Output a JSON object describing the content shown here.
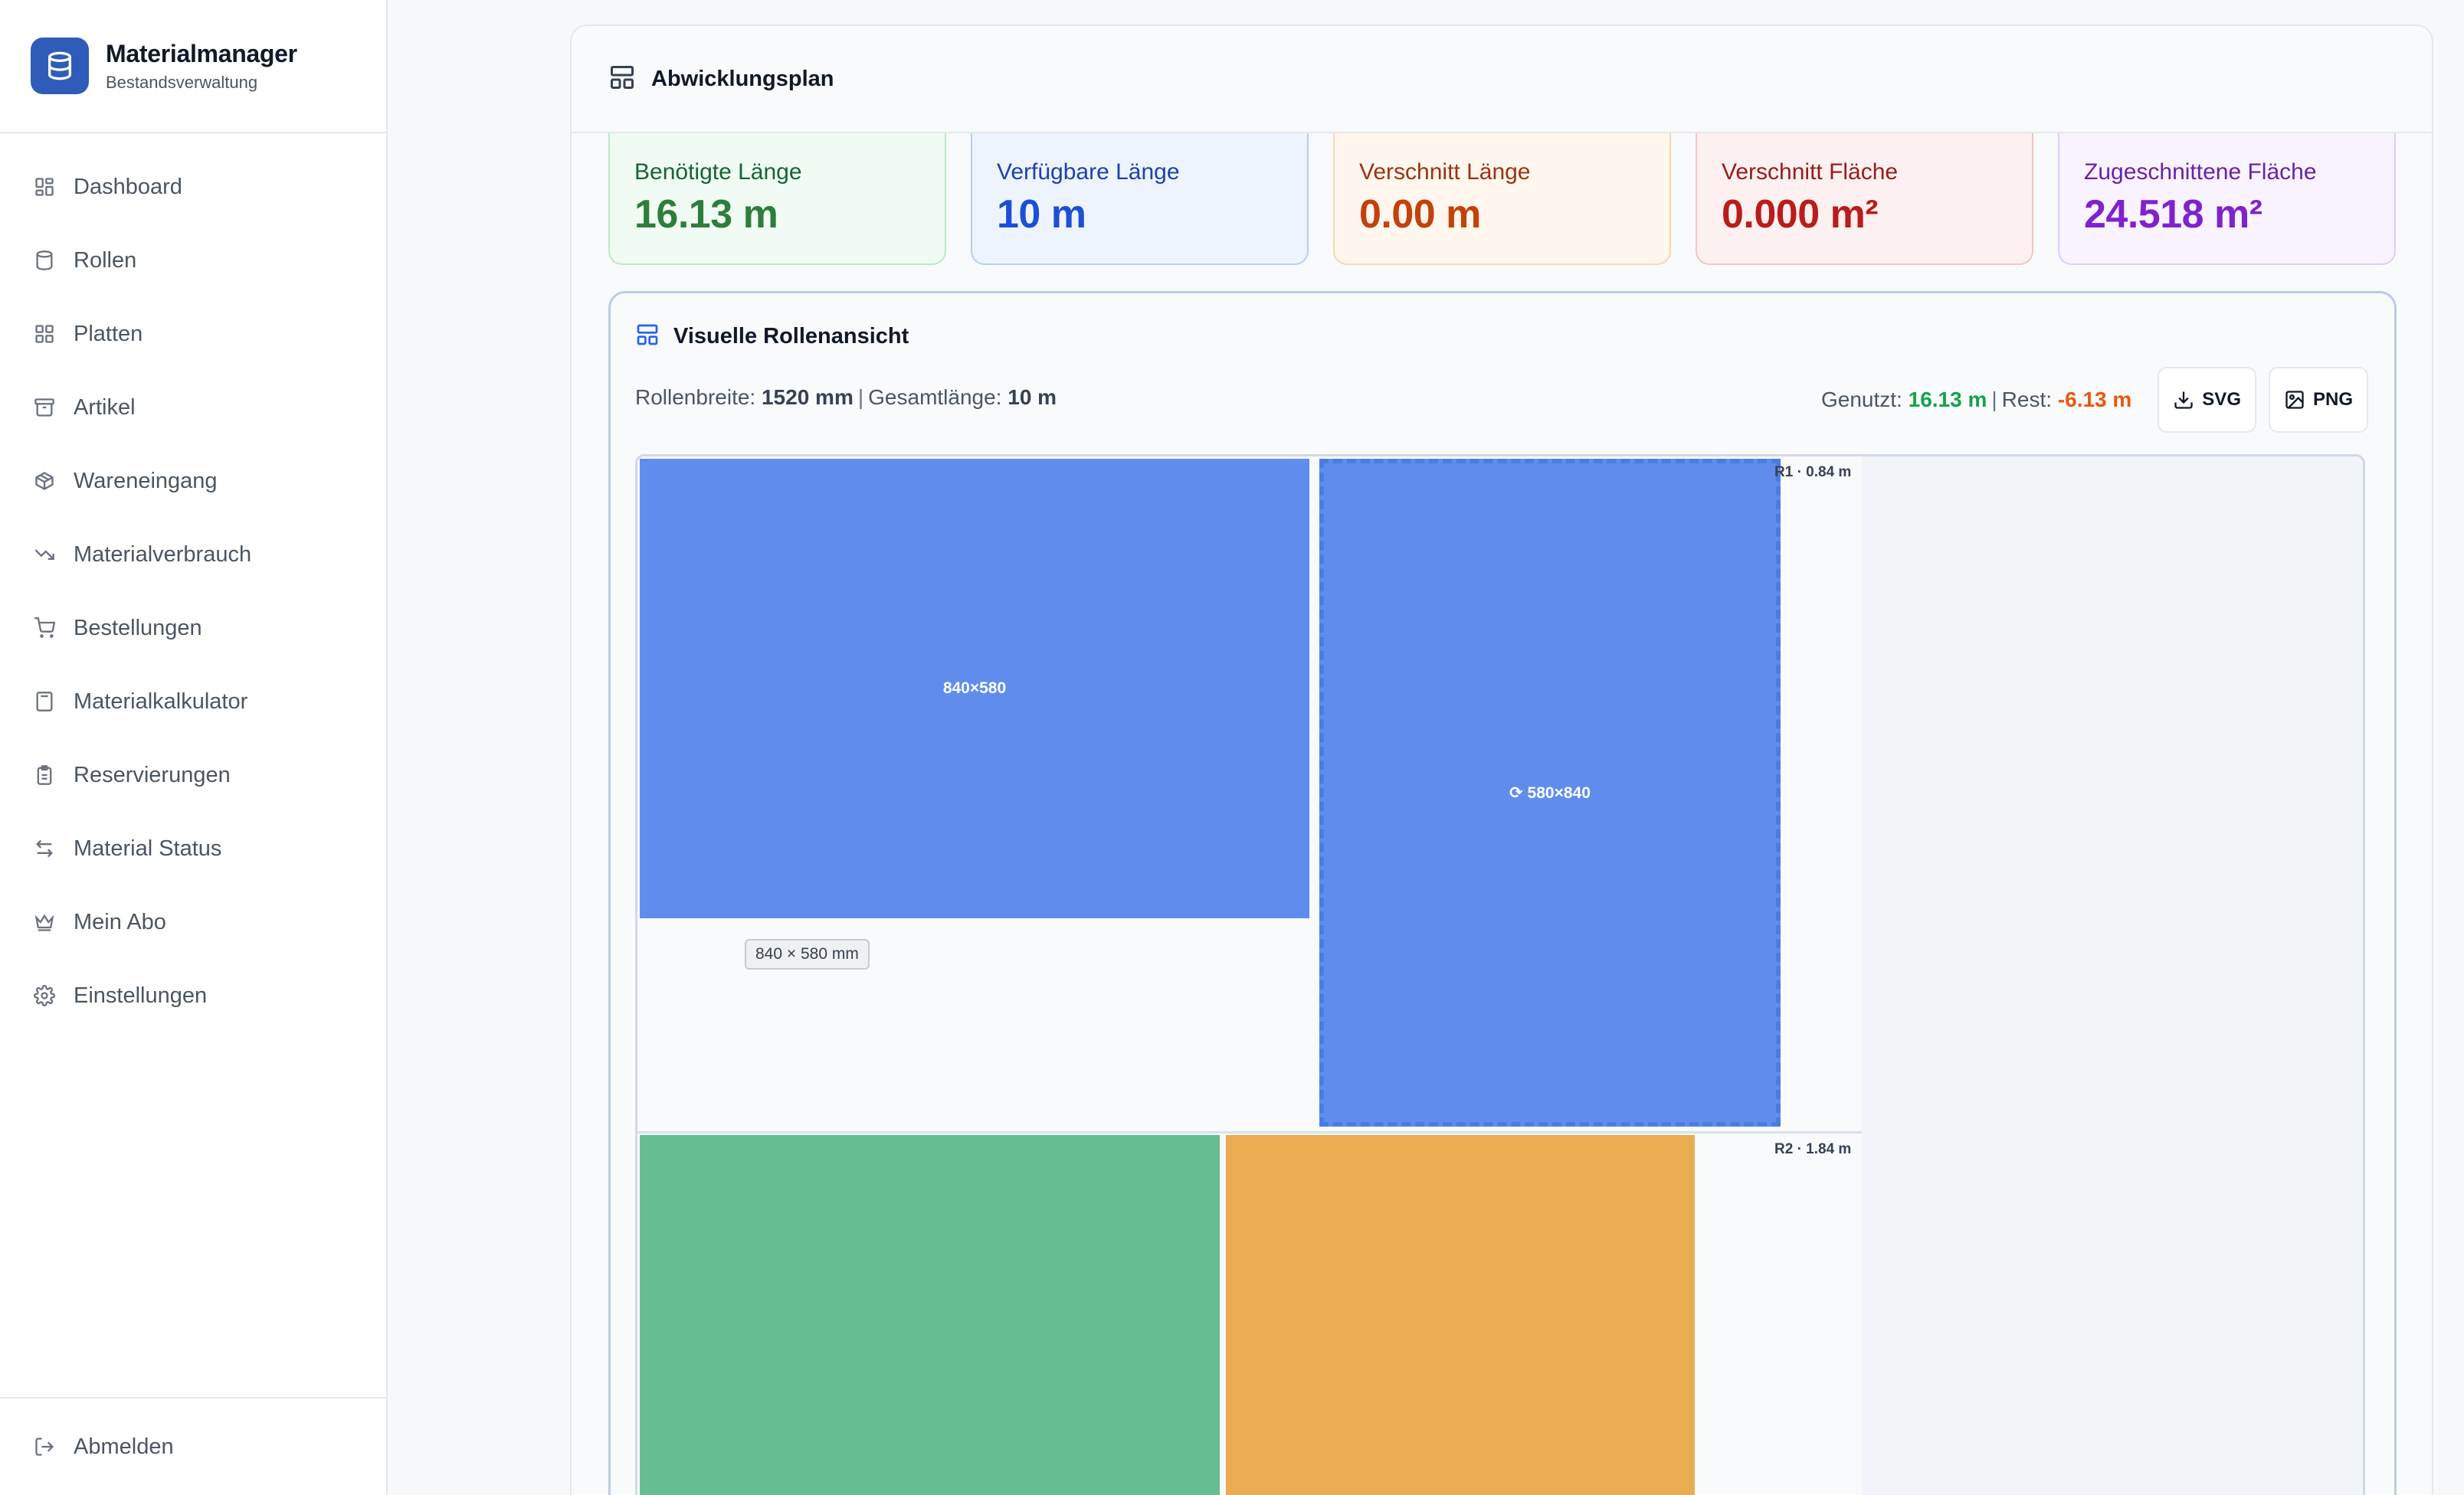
{
  "app": {
    "title": "Materialmanager",
    "subtitle": "Bestandsverwaltung",
    "logo_icon": "database-icon"
  },
  "sidebar": {
    "items": [
      {
        "label": "Dashboard",
        "icon": "dashboard-grid-icon"
      },
      {
        "label": "Rollen",
        "icon": "cylinder-icon"
      },
      {
        "label": "Platten",
        "icon": "grid-icon"
      },
      {
        "label": "Artikel",
        "icon": "archive-icon"
      },
      {
        "label": "Wareneingang",
        "icon": "package-icon"
      },
      {
        "label": "Materialverbrauch",
        "icon": "trending-down-icon"
      },
      {
        "label": "Bestellungen",
        "icon": "cart-icon"
      },
      {
        "label": "Materialkalkulator",
        "icon": "calculator-icon"
      },
      {
        "label": "Reservierungen",
        "icon": "clipboard-icon"
      },
      {
        "label": "Material Status",
        "icon": "arrows-swap-icon"
      },
      {
        "label": "Mein Abo",
        "icon": "crown-icon"
      },
      {
        "label": "Einstellungen",
        "icon": "gear-icon"
      }
    ],
    "logout_label": "Abmelden"
  },
  "panel": {
    "title": "Abwicklungsplan"
  },
  "stats": [
    {
      "label": "Benötigte Länge",
      "value": "16.13 m",
      "color": "green"
    },
    {
      "label": "Verfügbare Länge",
      "value": "10 m",
      "color": "blue"
    },
    {
      "label": "Verschnitt Länge",
      "value": "0.00 m",
      "color": "orange"
    },
    {
      "label": "Verschnitt Fläche",
      "value": "0.000 m²",
      "color": "red"
    },
    {
      "label": "Zugeschnittene Fläche",
      "value": "24.518 m²",
      "color": "purple"
    }
  ],
  "roll_view": {
    "title": "Visuelle Rollenansicht",
    "width_label": "Rollenbreite:",
    "width_value": "1520 mm",
    "length_label": "Gesamtlänge:",
    "length_value": "10 m",
    "used_label": "Genutzt:",
    "used_value": "16.13 m",
    "rest_label": "Rest:",
    "rest_value": "-6.13 m",
    "svg_button": "SVG",
    "png_button": "PNG"
  },
  "canvas": {
    "rows": [
      {
        "label": "R1 · 0.84 m"
      },
      {
        "label": "R2 · 1.84 m"
      }
    ],
    "pieces": [
      {
        "label": "840×580",
        "color": "blue",
        "selected": false
      },
      {
        "label": "⟳ 580×840",
        "color": "blue",
        "selected": true
      },
      {
        "label": "",
        "color": "green",
        "selected": false
      },
      {
        "label": "",
        "color": "orange",
        "selected": false
      }
    ],
    "tooltip": "840 × 580 mm",
    "colors": {
      "blue": "#608ded",
      "green": "#66bd8f",
      "orange": "#e9ac4e"
    }
  }
}
